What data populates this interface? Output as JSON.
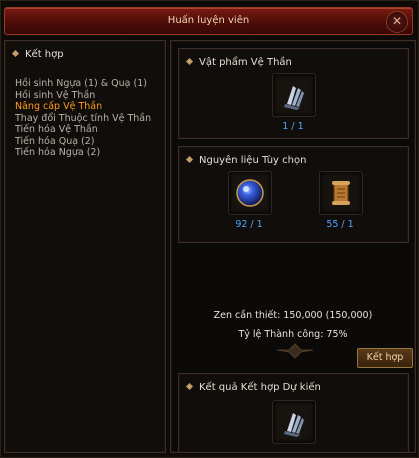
{
  "window": {
    "title": "Huấn luyện viên",
    "close_symbol": "✕"
  },
  "left_panel": {
    "header": "Kết hợp",
    "items": [
      "Hồi sinh Ngựa (1) & Quạ (1)",
      "Hồi sinh Vệ Thần",
      "Nâng cấp Vệ Thần",
      "Thay đổi Thuộc tính Vệ Thần",
      "Tiến hóa Vệ Thần",
      "Tiến hóa Quạ (2)",
      "Tiến hóa Ngựa (2)"
    ],
    "active_index": 2
  },
  "guardian_item": {
    "header": "Vật phẩm Vệ Thần",
    "icon": "guardian-claw-icon",
    "count": "1 / 1"
  },
  "materials": {
    "header": "Nguyên liệu Tùy chọn",
    "items": [
      {
        "icon": "jewel-orb-icon",
        "count": "92 / 1"
      },
      {
        "icon": "scroll-icon",
        "count": "55 / 1"
      }
    ]
  },
  "info": {
    "zen": "Zen cần thiết: 150,000 (150,000)",
    "success_rate": "Tỷ lệ Thành công: 75%"
  },
  "combine_button": "Kết hợp",
  "result": {
    "header": "Kết quả Kết hợp Dự kiến",
    "icon": "guardian-claw-icon"
  },
  "colors": {
    "title_bar": "#5a120b",
    "active_item": "#ff9a1a",
    "count_text": "#4fa6ff",
    "button_border": "#9a7640"
  }
}
